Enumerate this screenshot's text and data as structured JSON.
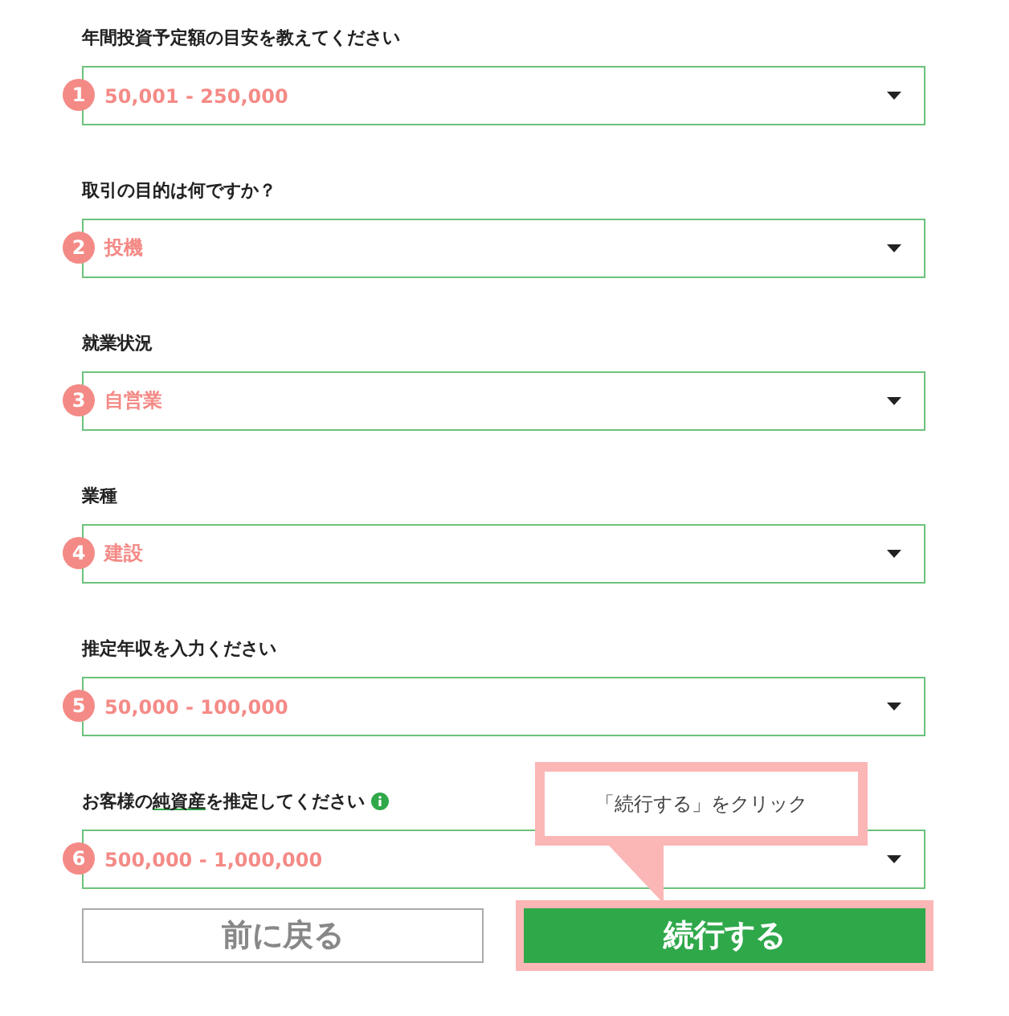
{
  "questions": [
    {
      "number": "1",
      "label": "年間投資予定額の目安を教えてください",
      "value": "50,001 - 250,000"
    },
    {
      "number": "2",
      "label": "取引の目的は何ですか？",
      "value": "投機"
    },
    {
      "number": "3",
      "label": "就業状況",
      "value": "自営業"
    },
    {
      "number": "4",
      "label": "業種",
      "value": "建設"
    },
    {
      "number": "5",
      "label": "推定年収を入力ください",
      "value": "50,000 - 100,000"
    },
    {
      "number": "6",
      "label": "お客様の",
      "term": "純資産",
      "label_after": "を推定してください",
      "info": true,
      "value": "500,000 - 1,000,000"
    }
  ],
  "tooltip": "「続行する」をクリック",
  "back_button": "前に戻る",
  "continue_button": "続行する"
}
